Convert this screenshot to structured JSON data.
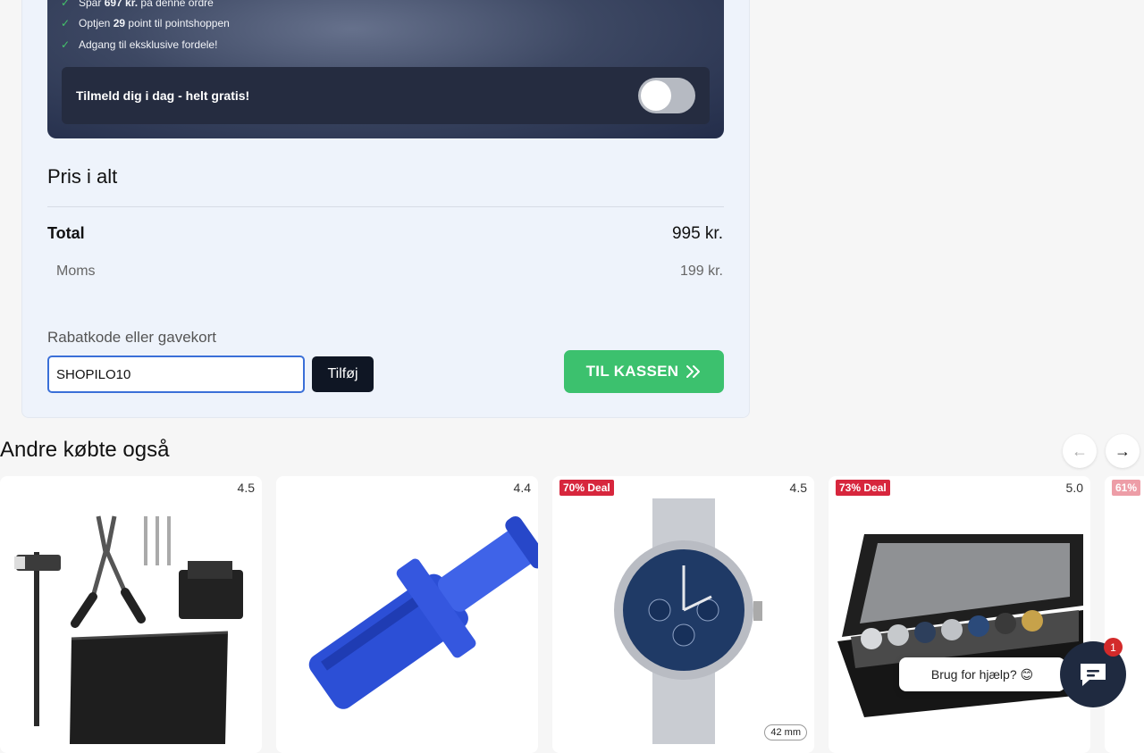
{
  "promo": {
    "items": [
      {
        "pre": "Spar ",
        "bold": "697 kr.",
        "post": " på denne ordre"
      },
      {
        "pre": "Optjen ",
        "bold": "29",
        "post": " point til pointshoppen"
      },
      {
        "pre": "Adgang til eksklusive fordele!",
        "bold": "",
        "post": ""
      }
    ],
    "join_label": "Tilmeld dig i dag - helt gratis!",
    "toggle_on": false
  },
  "summary": {
    "title": "Pris i alt",
    "total_label": "Total",
    "total_value": "995 kr.",
    "moms_label": "Moms",
    "moms_value": "199 kr."
  },
  "discount": {
    "label": "Rabatkode eller gavekort",
    "value": "SHOPILO10",
    "add_label": "Tilføj"
  },
  "checkout": {
    "label": "TIL KASSEN",
    "icon": "double-chevron-right-icon"
  },
  "related": {
    "title": "Andre købte også",
    "prev_icon": "arrow-left-icon",
    "next_icon": "arrow-right-icon",
    "products": [
      {
        "rating": "4.5",
        "deal": "",
        "size": "",
        "image": "watch-repair-tool-kit"
      },
      {
        "rating": "4.4",
        "deal": "",
        "size": "",
        "image": "watch-link-remover-tool"
      },
      {
        "rating": "4.5",
        "deal": "70% Deal",
        "size": "42 mm",
        "image": "chronograph-watch-cavetto"
      },
      {
        "rating": "5.0",
        "deal": "73% Deal",
        "size": "",
        "image": "watch-display-box"
      },
      {
        "rating": "",
        "deal": "61%",
        "size": "",
        "image": "partial-product"
      }
    ]
  },
  "chat": {
    "bubble_text": "Brug for hjælp? 😊",
    "badge_count": "1"
  },
  "colors": {
    "accent_green": "#3cc16e",
    "dark": "#0f1624",
    "deal_red": "#d7263d"
  }
}
